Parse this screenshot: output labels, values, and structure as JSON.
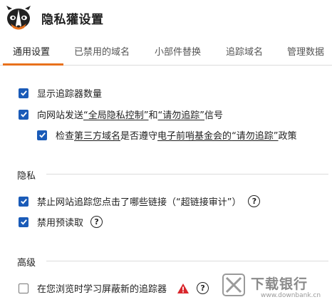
{
  "app": {
    "title": "隐私獾设置"
  },
  "tabs": [
    {
      "label": "通用设置",
      "active": true
    },
    {
      "label": "已禁用的域名",
      "active": false
    },
    {
      "label": "小部件替换",
      "active": false
    },
    {
      "label": "追踪域名",
      "active": false
    },
    {
      "label": "管理数据",
      "active": false
    }
  ],
  "general": {
    "show_count": {
      "label": "显示追踪器数量",
      "checked": true
    },
    "send_gpc": {
      "prefix": "向网站发送",
      "link1": "“全局隐私控制”",
      "middle": "和",
      "link2": "“请勿追踪”",
      "suffix": "信号",
      "checked": true
    },
    "check_dnt": {
      "prefix": "检查",
      "link1": "第三方域名",
      "middle": "是否遵守",
      "link2": "电子前哨基金会的",
      "link3": "“请勿追踪”",
      "suffix": "政策",
      "checked": true
    }
  },
  "privacy": {
    "title": "隐私",
    "block_hyperlink": {
      "label": "禁止网站追踪您点击了哪些链接（“超链接审计”）",
      "checked": true
    },
    "disable_prefetch": {
      "label": "禁用预读取",
      "checked": true
    }
  },
  "advanced": {
    "title": "高级",
    "learn_local": {
      "label": "在您浏览时学习屏蔽新的追踪器",
      "checked": false
    }
  },
  "icons": {
    "help": "?",
    "warning": "warning-icon"
  },
  "watermark": {
    "main": "下载银行",
    "sub": "www.downbank.cn"
  },
  "colors": {
    "accent": "#e8711c",
    "checkbox": "#1a5bb8",
    "warning": "#d9262c"
  }
}
